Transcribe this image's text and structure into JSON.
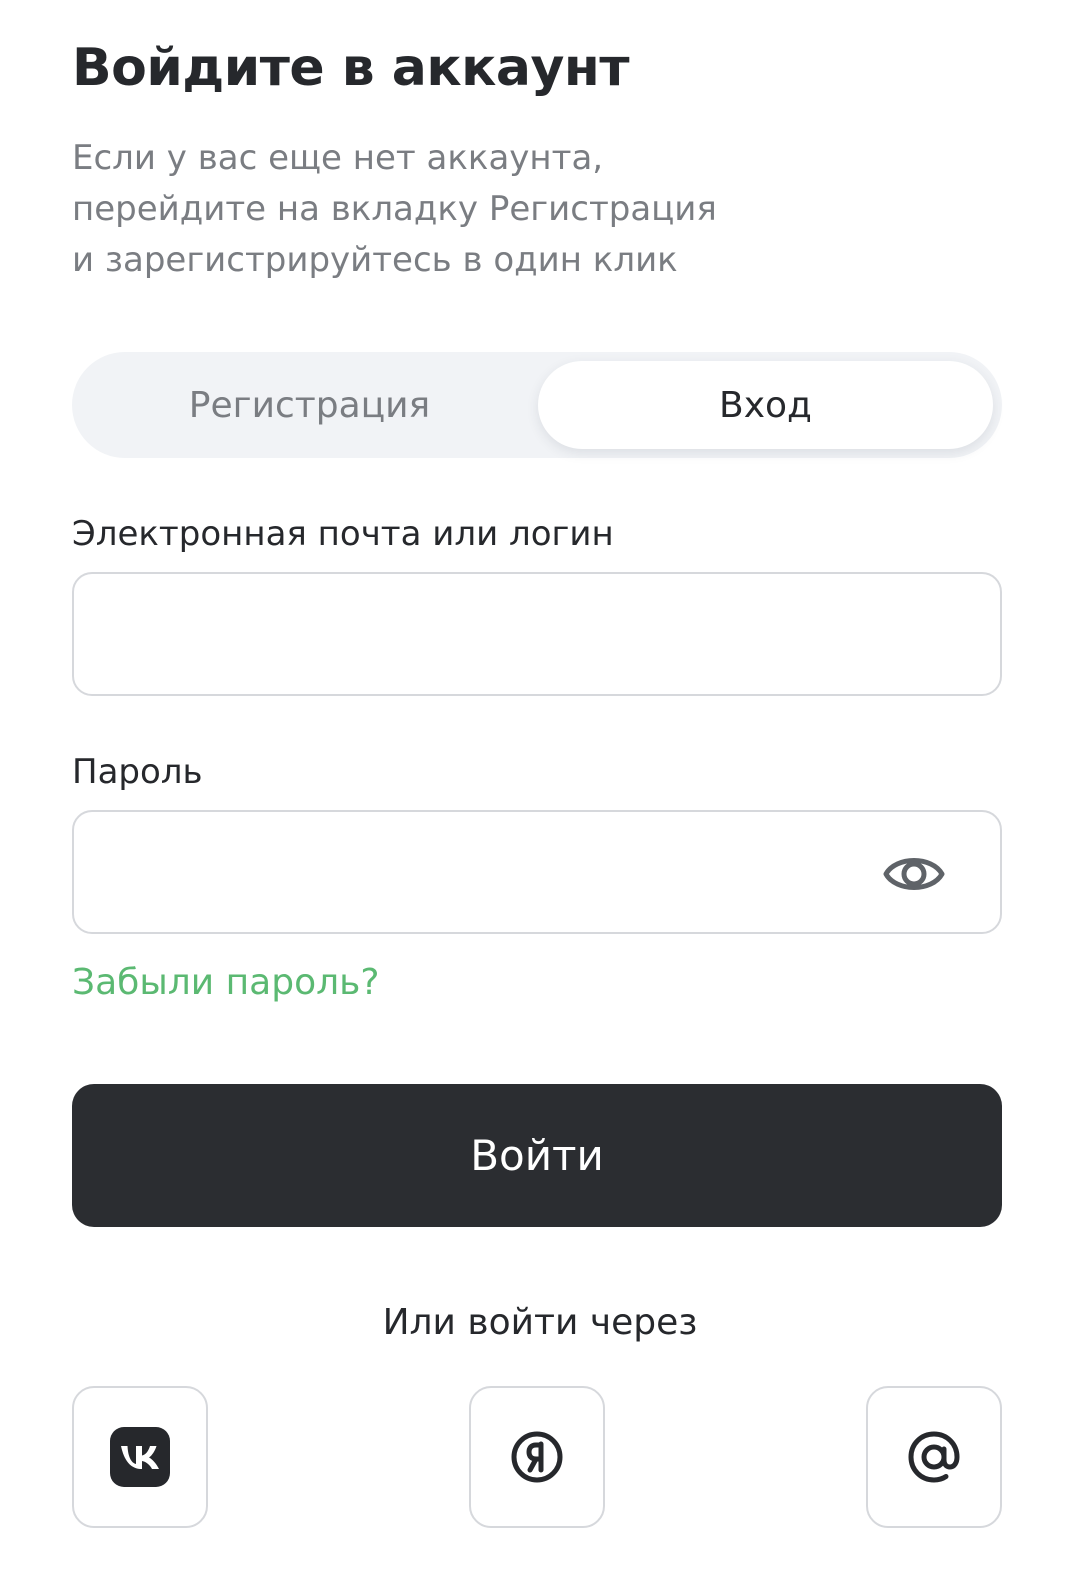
{
  "header": {
    "title": "Войдите в аккаунт",
    "subtitle_lines": [
      "Если у вас еще нет аккаунта,",
      "перейдите на вкладку Регистрация",
      "и зарегистрируйтесь в один клик"
    ]
  },
  "tabs": [
    {
      "label": "Регистрация",
      "active": false
    },
    {
      "label": "Вход",
      "active": true
    }
  ],
  "form": {
    "login": {
      "label": "Электронная почта или логин",
      "value": "",
      "placeholder": ""
    },
    "password": {
      "label": "Пароль",
      "value": "",
      "placeholder": "",
      "icon": "eye-icon"
    },
    "forgot_link": "Забыли пароль?",
    "submit_label": "Войти"
  },
  "social": {
    "label": "Или войти через",
    "providers": [
      {
        "name": "vk",
        "icon": "vk-logo-icon"
      },
      {
        "name": "yandex",
        "icon": "yandex-logo-icon"
      },
      {
        "name": "mail",
        "icon": "at-sign-icon"
      }
    ]
  },
  "colors": {
    "accent_green": "#5bb972",
    "button_dark": "#2b2d31",
    "text_primary": "#26282c",
    "text_secondary": "#7a7d82",
    "border": "#d6d8dc",
    "tab_bg": "#f1f3f6"
  }
}
